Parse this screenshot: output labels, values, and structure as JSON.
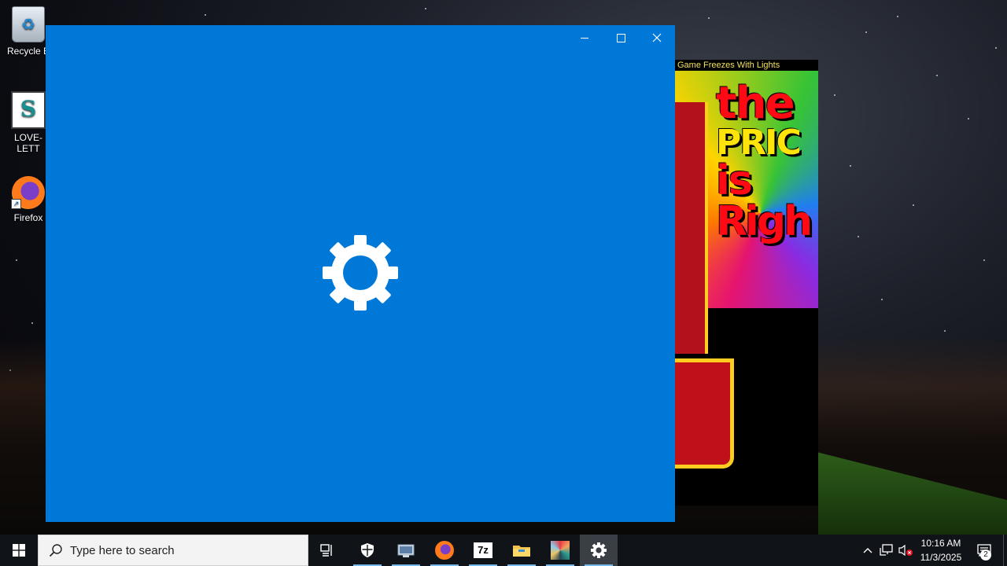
{
  "desktop": {
    "icons": [
      {
        "label": "Recycle B"
      },
      {
        "label": "LOVE-LETT"
      },
      {
        "label": "Firefox"
      }
    ]
  },
  "background_window": {
    "title": "Game Freezes With Lights",
    "logo": {
      "line1": "the",
      "line2": "PRIC",
      "line3": "is",
      "line4": "Righ"
    }
  },
  "settings_window": {
    "app": "Settings",
    "background_color": "#0078d7",
    "splash_icon": "gear-icon",
    "controls": {
      "minimize": "minimize-icon",
      "maximize": "maximize-icon",
      "close": "close-icon"
    }
  },
  "taskbar": {
    "search_placeholder": "Type here to search",
    "apps": [
      {
        "name": "task-view",
        "icon": "task-view-icon"
      },
      {
        "name": "windows-security",
        "icon": "shield-icon"
      },
      {
        "name": "virtual-machine",
        "icon": "vm-icon"
      },
      {
        "name": "firefox",
        "icon": "firefox-icon"
      },
      {
        "name": "7-zip",
        "icon": "7zip-icon",
        "label": "7z"
      },
      {
        "name": "file-explorer",
        "icon": "folder-icon"
      },
      {
        "name": "app",
        "icon": "starburst-icon"
      },
      {
        "name": "settings",
        "icon": "gear-icon"
      }
    ],
    "clock": {
      "time": "10:16 AM",
      "date": "11/3/2025"
    },
    "notifications_count": "2"
  }
}
